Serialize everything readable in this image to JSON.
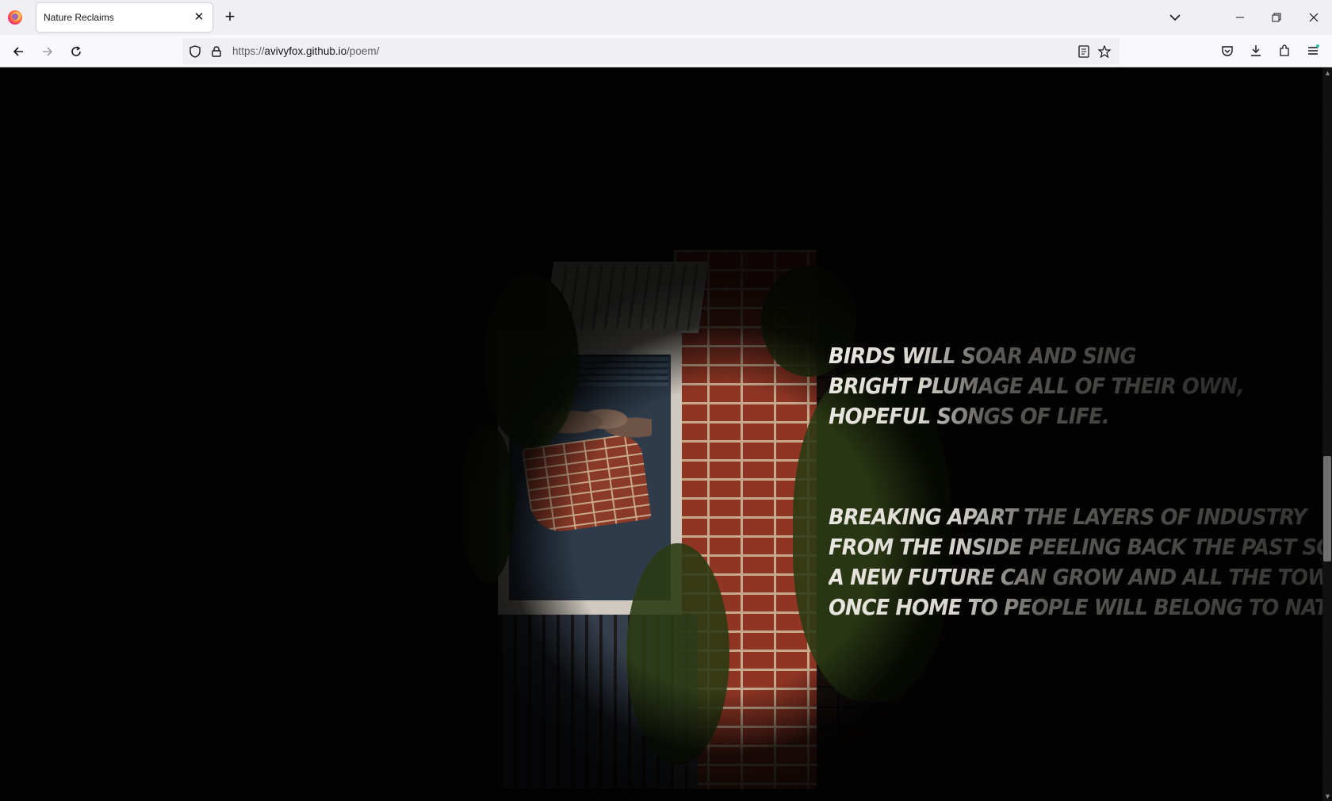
{
  "browser": {
    "tab_title": "Nature Reclaims",
    "url_scheme": "https://",
    "url_host": "avivyfox.github.io",
    "url_path": "/poem/"
  },
  "icons": {
    "tab": [
      "firefox-logo-icon",
      "close-icon",
      "plus-icon",
      "chevron-down-icon"
    ],
    "window": [
      "minimize-icon",
      "restore-icon",
      "close-icon"
    ],
    "nav": [
      "back-arrow-icon",
      "forward-arrow-icon",
      "reload-icon"
    ],
    "url": [
      "shield-icon",
      "lock-icon",
      "reader-view-icon",
      "star-icon"
    ],
    "toolbar": [
      "pocket-icon",
      "download-icon",
      "extensions-icon",
      "menu-icon"
    ]
  },
  "poem": {
    "stanza1": [
      "Birds will soar and sing",
      "Bright plumage all of their own,",
      "Hopeful songs of life."
    ],
    "stanza2": [
      "Breaking apart the layers of industry",
      "From the inside peeling back the past so that",
      "A new future can grow and all the towers,",
      "Once home to people will belong to nature."
    ]
  },
  "colors": {
    "poem_text": "#e8e6df",
    "brick_red": "#8e3524",
    "vine_green": "#2b3b14",
    "scroll_thumb": "#6f6f6f"
  }
}
